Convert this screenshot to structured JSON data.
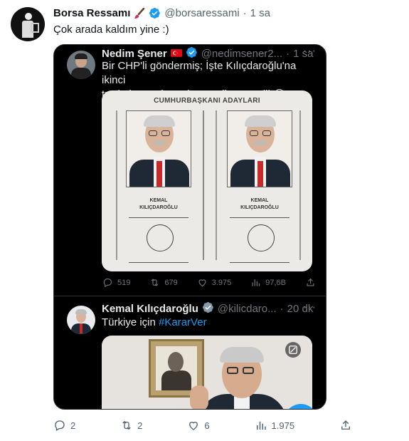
{
  "outer_tweet": {
    "display_name": "Borsa Ressamı",
    "handle": "@borsaressami",
    "separator": "·",
    "time": "1 sa",
    "text": "Çok arada kaldım yine :)",
    "actions": {
      "replies": "2",
      "retweets": "2",
      "likes": "6",
      "views": "1.975"
    }
  },
  "quoted_tweet": {
    "display_name": "Nedim Şener",
    "handle": "@nedimsener2...",
    "separator": "·",
    "time": "1 sa",
    "text_line1": "Bir CHP'li göndermiş; İşte Kılıçdaroğlu'na ikinci",
    "text_line2": "turda kazandıracak strateji, garantili 😂",
    "ballot": {
      "title": "CUMHURBAŞKANI ADAYLARI",
      "candidates": [
        {
          "name_line1": "KEMAL",
          "name_line2": "KILIÇDAROĞLU"
        },
        {
          "name_line1": "KEMAL",
          "name_line2": "KILIÇDAROĞLU"
        }
      ]
    },
    "actions": {
      "replies": "519",
      "retweets": "679",
      "likes": "3.975",
      "views": "97,6B"
    }
  },
  "nested_tweet": {
    "display_name": "Kemal Kılıçdaroğlu",
    "handle": "@kilicdaro...",
    "separator": "·",
    "time": "20 dk",
    "text_prefix": "Türkiye için ",
    "hashtag": "#KararVer"
  },
  "colors": {
    "accent": "#1d9bf0",
    "verified": "#1d9bf0",
    "dark_bg": "#000000"
  },
  "icons": [
    "more-dots-icon",
    "verified-badge-icon",
    "turkish-flag-icon",
    "paintbrush-icon",
    "reply-icon",
    "retweet-icon",
    "like-icon",
    "views-icon",
    "share-icon",
    "gif-icon"
  ]
}
